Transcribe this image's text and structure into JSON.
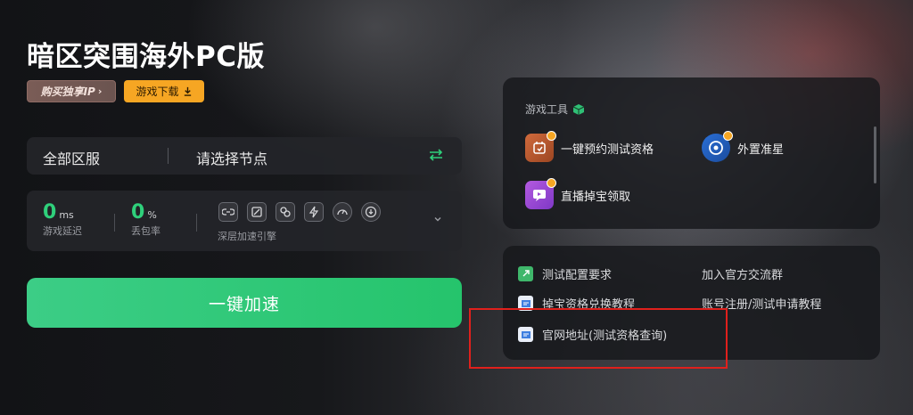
{
  "game": {
    "title": "暗区突围海外PC版",
    "buy_ip_label": "购买独享IP",
    "download_label": "游戏下载"
  },
  "server": {
    "region": "全部区服",
    "node_placeholder": "请选择节点"
  },
  "stats": {
    "latency_value": "0",
    "latency_unit": "ms",
    "latency_label": "游戏延迟",
    "loss_value": "0",
    "loss_unit": "%",
    "loss_label": "丢包率",
    "engine_label": "深层加速引擎",
    "engine_icons": [
      "link-mode-icon",
      "screen-mode-icon",
      "chain-mode-icon",
      "lightning-mode-icon",
      "speed-dial-icon",
      "download-mode-icon"
    ]
  },
  "accelerate_label": "一键加速",
  "tools": {
    "title": "游戏工具",
    "items": [
      {
        "label": "一键预约测试资格",
        "icon": "calendar-icon"
      },
      {
        "label": "外置准星",
        "icon": "crosshair-icon"
      },
      {
        "label": "直播掉宝领取",
        "icon": "live-gift-icon"
      }
    ]
  },
  "links": {
    "items": [
      {
        "label": "测试配置要求",
        "icon": "link-icon"
      },
      {
        "label": "加入官方交流群",
        "icon": ""
      },
      {
        "label": "掉宝资格兑换教程",
        "icon": "doc-icon"
      },
      {
        "label": "账号注册/测试申请教程",
        "icon": ""
      },
      {
        "label": "官网地址(测试资格查询)",
        "icon": "doc-icon"
      }
    ]
  },
  "colors": {
    "accent_green": "#2fd07b",
    "download_orange": "#f6a623",
    "highlight_red": "#e0201c"
  }
}
